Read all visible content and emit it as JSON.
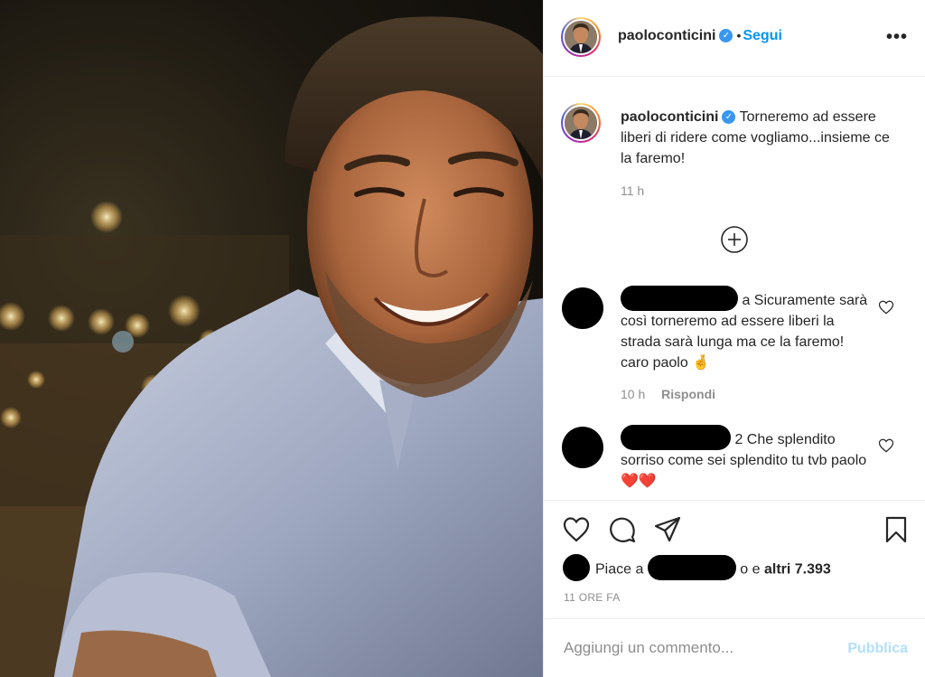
{
  "post": {
    "username": "paoloconticini",
    "follow_label": "Segui",
    "more_icon": "more-options-icon",
    "caption": "Torneremo ad essere liberi di ridere come vogliamo...insieme ce la faremo!",
    "caption_time": "11 h"
  },
  "comments": [
    {
      "text": "a Sicuramente sarà così torneremo ad essere liberi la strada sarà lunga ma ce la faremo! caro paolo 🤞",
      "time": "10 h",
      "reply_label": "Rispondi"
    },
    {
      "text": "2 Che splendito sorriso come sei splendito tu tvb paolo❤️❤️",
      "time": "",
      "reply_label": ""
    }
  ],
  "likes": {
    "prefix": "Piace a",
    "middle": "o e",
    "count_text": "altri 7.393"
  },
  "posted_ago": "11 ORE FA",
  "comment_box": {
    "placeholder": "Aggiungi un commento...",
    "publish_label": "Pubblica"
  },
  "colors": {
    "follow": "#0095f6",
    "publish_disabled": "#b2dffc",
    "verified": "#3897f0",
    "heart_emoji": "#e0245e"
  }
}
